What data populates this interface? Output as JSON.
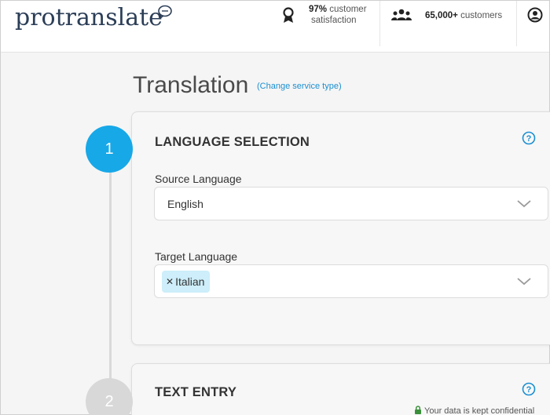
{
  "header": {
    "logo": "protranslate",
    "satisfaction": {
      "bold": "97%",
      "text": " customer",
      "line2": "satisfaction"
    },
    "customers": {
      "bold": "65,000+",
      "text": " customers"
    }
  },
  "page": {
    "title": "Translation",
    "change_link": "(Change service type)"
  },
  "steps": [
    {
      "number": "1",
      "title": "LANGUAGE SELECTION",
      "state": "active"
    },
    {
      "number": "2",
      "title": "TEXT ENTRY",
      "state": "inactive"
    }
  ],
  "language_selection": {
    "source_label": "Source Language",
    "source_value": "English",
    "target_label": "Target Language",
    "target_tags": [
      "Italian"
    ]
  },
  "footer": {
    "privacy_text": "Your data is kept confidential"
  },
  "colors": {
    "accent": "#17a8e8",
    "logo": "#2c3e57",
    "tag_bg": "#cdeefa",
    "link": "#1b8fd1"
  }
}
